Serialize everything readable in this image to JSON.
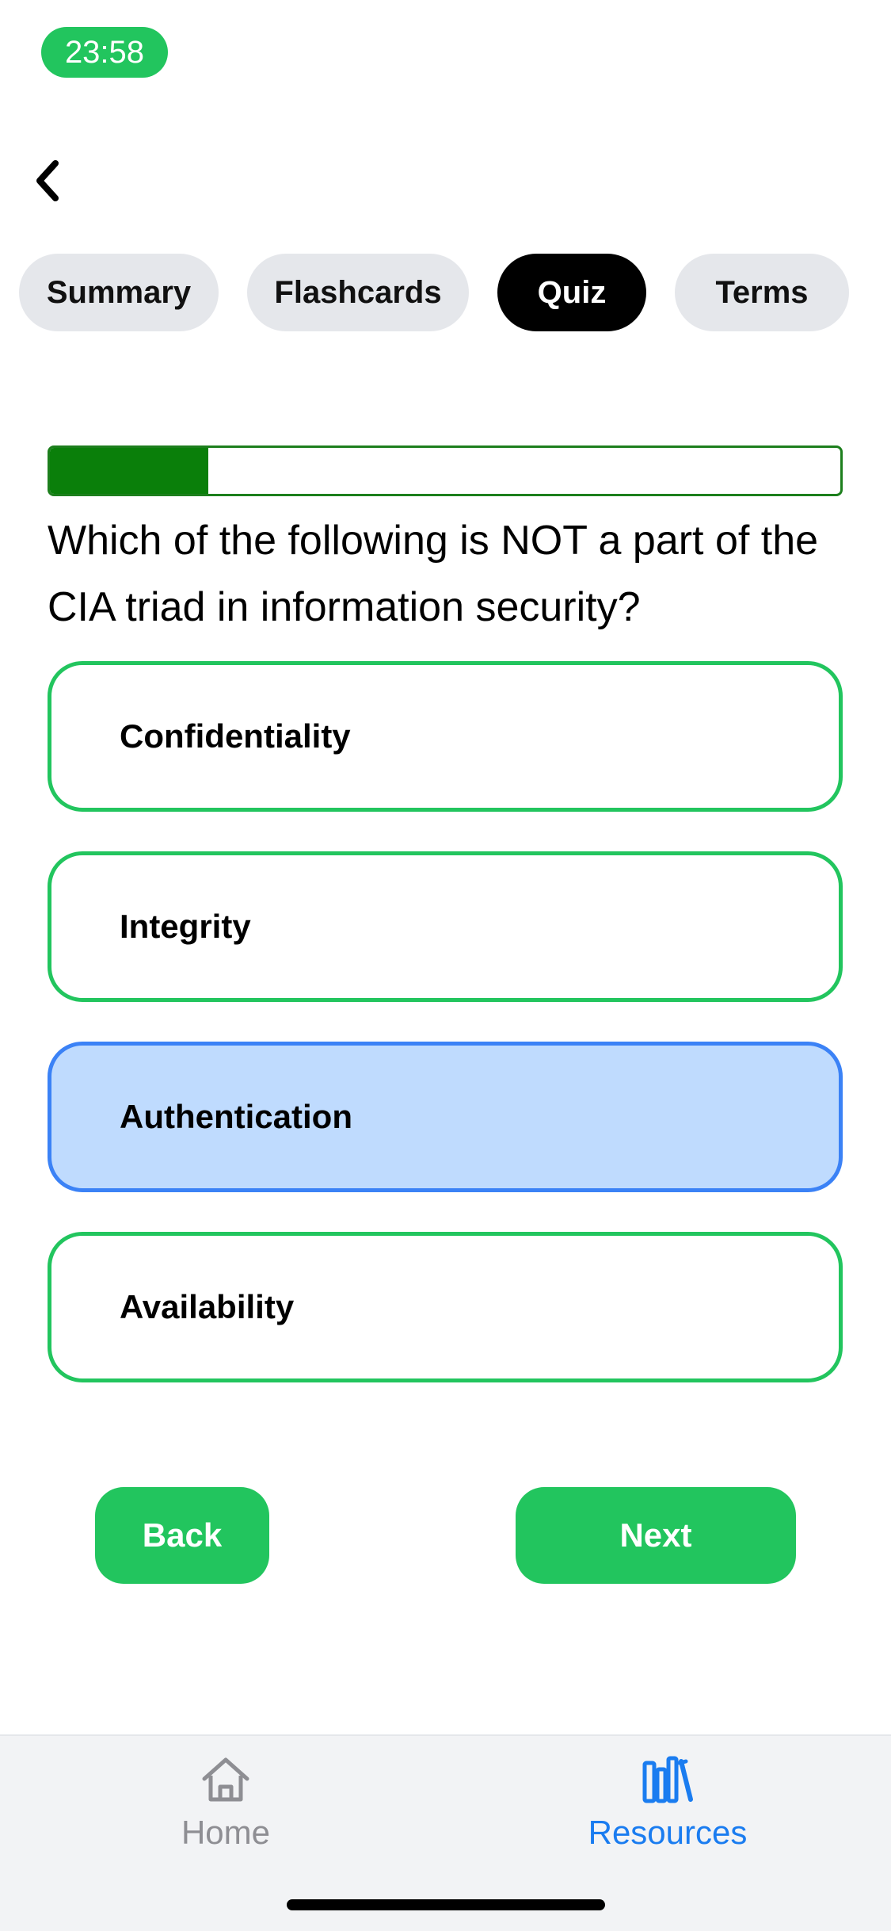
{
  "status_bar": {
    "time": "23:58"
  },
  "tabs": [
    {
      "label": "Summary",
      "active": false
    },
    {
      "label": "Flashcards",
      "active": false
    },
    {
      "label": "Quiz",
      "active": true
    },
    {
      "label": "Terms",
      "active": false
    }
  ],
  "quiz": {
    "progress_fraction": 0.2,
    "question": "Which of the following is NOT a part of the CIA triad in information security?",
    "options": [
      {
        "label": "Confidentiality",
        "selected": false
      },
      {
        "label": "Integrity",
        "selected": false
      },
      {
        "label": "Authentication",
        "selected": true
      },
      {
        "label": "Availability",
        "selected": false
      }
    ],
    "back_label": "Back",
    "next_label": "Next"
  },
  "tab_bar": {
    "items": [
      {
        "label": "Home",
        "icon": "home-icon",
        "active": false
      },
      {
        "label": "Resources",
        "icon": "books-icon",
        "active": true
      }
    ]
  },
  "colors": {
    "accent_green": "#22c55e",
    "progress_green": "#0a7f0a",
    "selected_blue": "#3b82f6",
    "selected_bg": "#bfdbfe",
    "tab_active": "#000000",
    "tabbar_active": "#1a7cf0",
    "tabbar_inactive": "#8e8e93"
  }
}
